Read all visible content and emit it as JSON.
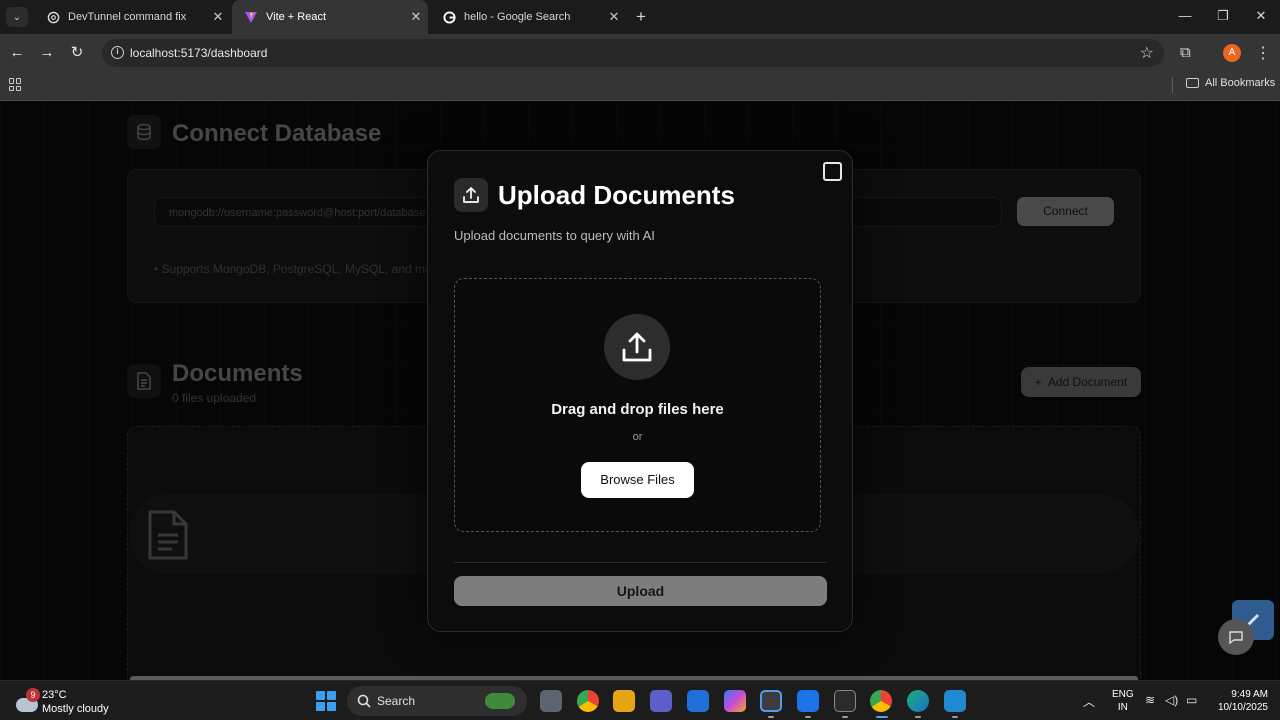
{
  "browser": {
    "tabs": [
      {
        "title": "DevTunnel command fix",
        "active": false
      },
      {
        "title": "Vite + React",
        "active": true
      },
      {
        "title": "hello - Google Search",
        "active": false
      }
    ],
    "url": "localhost:5173/dashboard",
    "profile_initial": "A",
    "all_bookmarks": "All Bookmarks"
  },
  "dashboard": {
    "connect": {
      "title": "Connect Database",
      "placeholder": "mongodb://username:password@host:port/database",
      "button": "Connect",
      "supports": "• Supports MongoDB, PostgreSQL, MySQL, and more"
    },
    "documents": {
      "title": "Documents",
      "count": "0 files uploaded",
      "add_button": "Add Document"
    }
  },
  "modal": {
    "title": "Upload Documents",
    "subtitle": "Upload documents to query with AI",
    "drop_text": "Drag and drop files here",
    "or": "or",
    "browse": "Browse Files",
    "upload": "Upload"
  },
  "taskbar": {
    "weather_badge": "9",
    "temperature": "23°C",
    "condition": "Mostly cloudy",
    "search": "Search",
    "lang_top": "ENG",
    "lang_bottom": "IN",
    "time": "9:49 AM",
    "date": "10/10/2025"
  },
  "colors": {
    "accent_blue": "#3aa0f2",
    "profile": "#e8671f",
    "modal_bg": "#0c0c0c"
  }
}
